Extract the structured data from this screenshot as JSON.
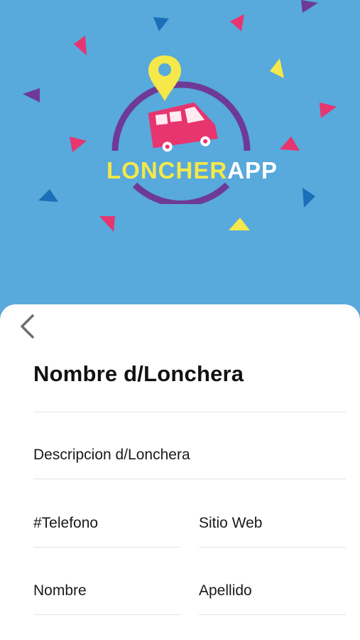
{
  "app": {
    "logo_text_part1": "LONCHER",
    "logo_text_part2": "APP"
  },
  "form": {
    "back_icon": "chevron-left-icon",
    "title_field": "Nombre d/Lonchera",
    "description_field": "Descripcion d/Lonchera",
    "phone_field": "#Telefono",
    "website_field": "Sitio Web",
    "first_name_field": "Nombre",
    "last_name_field": "Apellido"
  },
  "colors": {
    "hero_background": "#58a9dc",
    "logo_ring": "#6e3a96",
    "truck": "#e7356f",
    "pin": "#f4e84a",
    "confetti_pink": "#e7356f",
    "confetti_blue": "#1b6fb8",
    "confetti_purple": "#6e3a96",
    "confetti_yellow": "#f4e84a"
  }
}
